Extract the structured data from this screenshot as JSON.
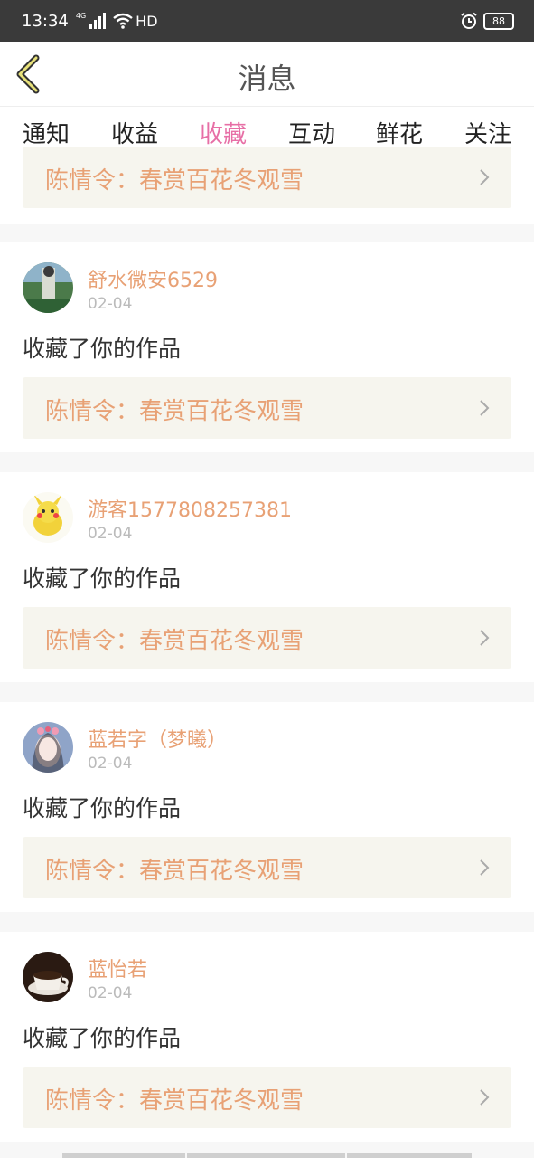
{
  "status_bar": {
    "time": "13:34",
    "network": "4G",
    "hd": "HD",
    "battery": "88"
  },
  "header": {
    "title": "消息"
  },
  "tabs": [
    {
      "label": "通知"
    },
    {
      "label": "收益"
    },
    {
      "label": "收藏"
    },
    {
      "label": "互动"
    },
    {
      "label": "鲜花"
    },
    {
      "label": "关注"
    }
  ],
  "active_tab": "收藏",
  "items": [
    {
      "work_title": "陈情令：春赏百花冬观雪"
    },
    {
      "user": "舒水微安6529",
      "date": "02-04",
      "action": "收藏了你的作品",
      "work_title": "陈情令：春赏百花冬观雪"
    },
    {
      "user": "游客1577808257381",
      "date": "02-04",
      "action": "收藏了你的作品",
      "work_title": "陈情令：春赏百花冬观雪"
    },
    {
      "user": "蓝若字（梦曦）",
      "date": "02-04",
      "action": "收藏了你的作品",
      "work_title": "陈情令：春赏百花冬观雪"
    },
    {
      "user": "蓝怡若",
      "date": "02-04",
      "action": "收藏了你的作品",
      "work_title": "陈情令：春赏百花冬观雪"
    }
  ],
  "colors": {
    "accent": "#e76fa6",
    "username": "#e8a175",
    "link_bg": "#f6f5ee"
  },
  "icons": [
    "back-chevron-icon",
    "chevron-right-icon",
    "wifi-icon",
    "alarm-icon",
    "battery-icon",
    "signal-icon"
  ]
}
